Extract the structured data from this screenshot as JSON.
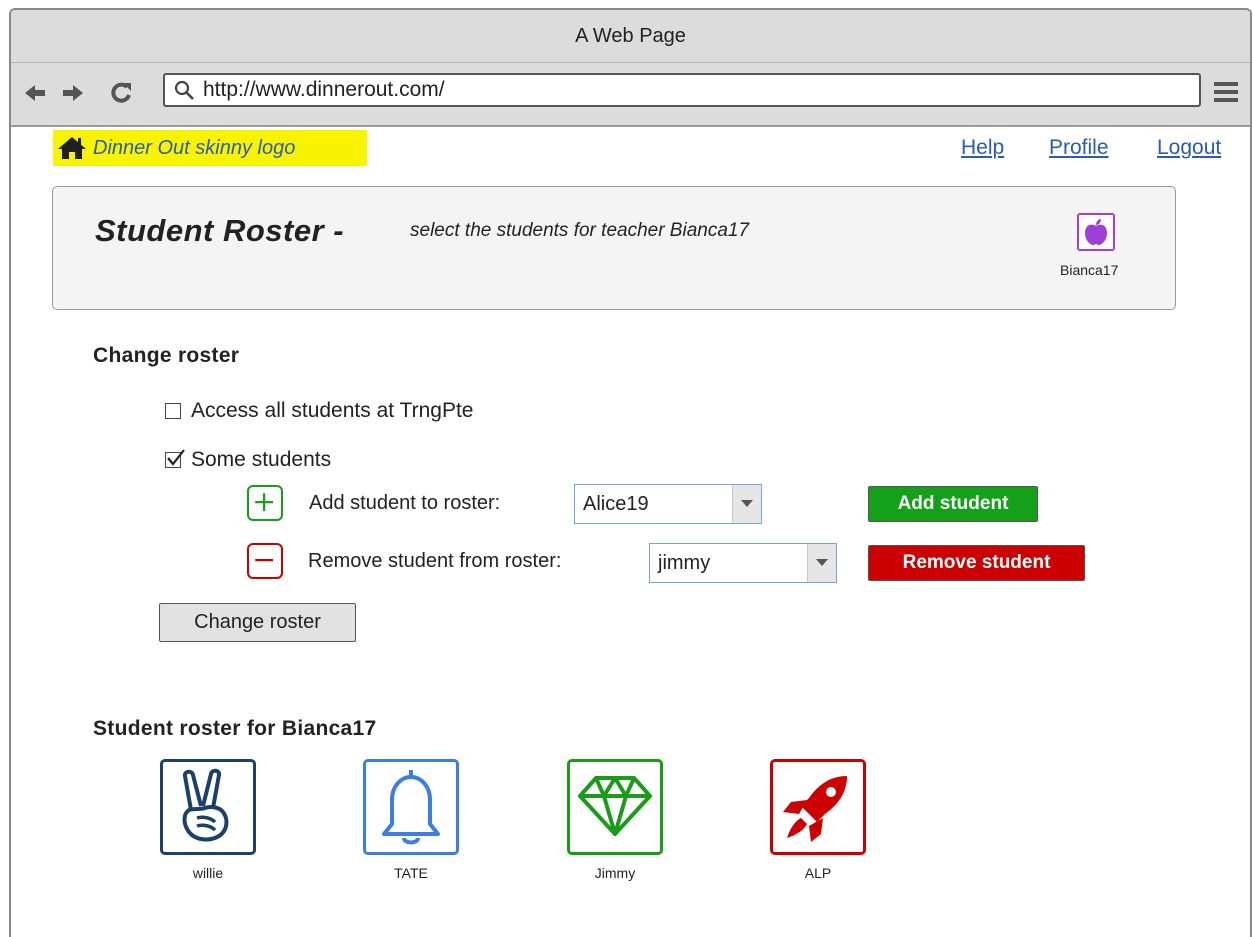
{
  "window": {
    "title": "A Web Page"
  },
  "browser": {
    "url": "http://www.dinnerout.com/",
    "back_icon": "arrow-left-icon",
    "forward_icon": "arrow-right-icon",
    "reload_icon": "reload-icon",
    "search_icon": "search-icon",
    "menu_icon": "hamburger-menu-icon"
  },
  "header": {
    "logo_text": "Dinner Out skinny logo",
    "logo_icon": "home-icon",
    "links": {
      "help": "Help",
      "profile": "Profile",
      "logout": "Logout"
    }
  },
  "banner": {
    "title": "Student Roster -",
    "subtitle": "select the students for teacher Bianca17",
    "avatar_icon": "apple-icon",
    "avatar_name": "Bianca17"
  },
  "change_roster": {
    "heading": "Change roster",
    "access_all": {
      "label": "Access all students at TrngPte",
      "checked": false
    },
    "some_students": {
      "label": "Some students",
      "checked": true
    },
    "add": {
      "label": "Add student to roster:",
      "selected": "Alice19",
      "button": "Add student"
    },
    "remove": {
      "label": "Remove student from roster:",
      "selected": "jimmy",
      "button": "Remove student"
    },
    "submit_button": "Change roster"
  },
  "roster": {
    "heading": "Student roster for Bianca17",
    "students": [
      {
        "name": "willie",
        "icon": "peace-hand-icon",
        "color": "#1d3f6b"
      },
      {
        "name": "TATE",
        "icon": "bell-icon",
        "color": "#3b7fe0"
      },
      {
        "name": "Jimmy",
        "icon": "diamond-icon",
        "color": "#1a9b1a"
      },
      {
        "name": "ALP",
        "icon": "rocket-icon",
        "color": "#cc0000"
      }
    ]
  },
  "colors": {
    "link": "#2a5bb5",
    "logo_bg": "#f8f400",
    "add_green": "#15a01a",
    "remove_red": "#cc0000",
    "avatar_purple": "#9e3fd8"
  }
}
